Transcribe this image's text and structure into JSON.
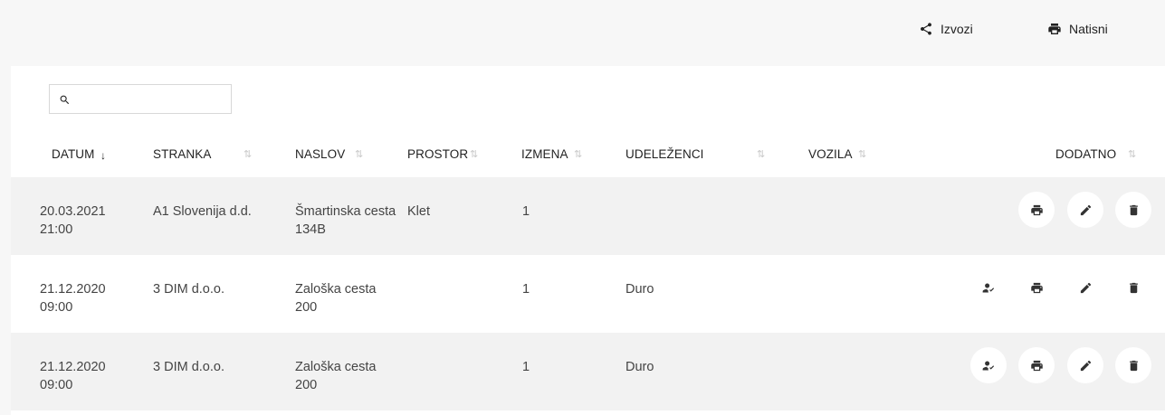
{
  "toolbar": {
    "export_label": "Izvozi",
    "print_label": "Natisni"
  },
  "search": {
    "value": "",
    "placeholder": ""
  },
  "table": {
    "headers": {
      "datum": "DATUM",
      "stranka": "STRANKA",
      "naslov": "NASLOV",
      "prostor": "PROSTOR",
      "izmena": "IZMENA",
      "udelezenci": "UDELEŽENCI",
      "vozila": "VOZILA",
      "dodatno": "DODATNO"
    },
    "sort_active_icon": "↓",
    "sort_icon": "⇅",
    "rows": [
      {
        "datum_date": "20.03.2021",
        "datum_time": "21:00",
        "stranka": "A1 Slovenija d.d.",
        "naslov_1": "Šmartinska cesta",
        "naslov_2": "134B",
        "prostor": "Klet",
        "izmena": "1",
        "udelezenci": "",
        "vozila": ""
      },
      {
        "datum_date": "21.12.2020",
        "datum_time": "09:00",
        "stranka": "3 DIM d.o.o.",
        "naslov_1": "Zaloška cesta",
        "naslov_2": "200",
        "prostor": "",
        "izmena": "1",
        "udelezenci": "Duro",
        "vozila": ""
      },
      {
        "datum_date": "21.12.2020",
        "datum_time": "09:00",
        "stranka": "3 DIM d.o.o.",
        "naslov_1": "Zaloška cesta",
        "naslov_2": "200",
        "prostor": "",
        "izmena": "1",
        "udelezenci": "Duro",
        "vozila": ""
      }
    ]
  },
  "icons": {
    "share": "share-icon",
    "print": "print-icon",
    "search": "search-icon",
    "edit": "pencil-icon",
    "delete": "trash-icon",
    "assign": "person-check-icon"
  }
}
